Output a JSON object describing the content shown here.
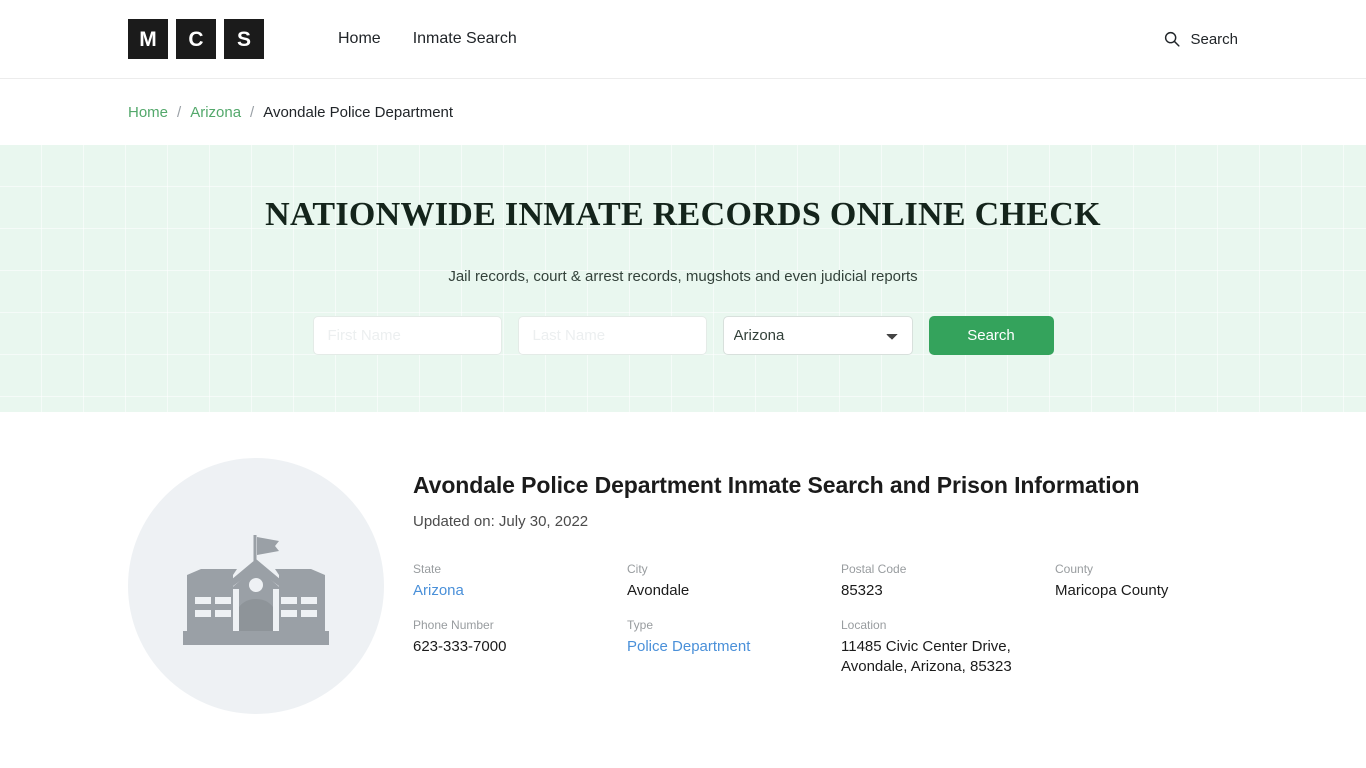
{
  "header": {
    "logo_letters": [
      "M",
      "C",
      "S"
    ],
    "nav": [
      {
        "label": "Home"
      },
      {
        "label": "Inmate Search"
      }
    ],
    "search_label": "Search",
    "search_icon": "search-icon"
  },
  "breadcrumb": {
    "items": [
      {
        "label": "Home",
        "link": true
      },
      {
        "label": "Arizona",
        "link": true
      },
      {
        "label": "Avondale Police Department",
        "link": false
      }
    ],
    "separator": "/"
  },
  "hero": {
    "title": "NATIONWIDE INMATE RECORDS ONLINE CHECK",
    "subtitle": "Jail records, court & arrest records, mugshots and even judicial reports",
    "form": {
      "first_name_placeholder": "First Name",
      "first_name_value": "",
      "last_name_placeholder": "Last Name",
      "last_name_value": "",
      "state_selected": "Arizona",
      "state_options": [
        "Arizona"
      ],
      "submit_label": "Search"
    },
    "background_color": "#e9f7ef",
    "accent_color": "#34a35c"
  },
  "main": {
    "thumbnail_icon": "government-building-icon",
    "title": "Avondale Police Department Inmate Search and Prison Information",
    "updated": "Updated on: July 30, 2022",
    "details": [
      {
        "label": "State",
        "value": "Arizona",
        "link": true
      },
      {
        "label": "City",
        "value": "Avondale",
        "link": false
      },
      {
        "label": "Postal Code",
        "value": "85323",
        "link": false
      },
      {
        "label": "County",
        "value": "Maricopa County",
        "link": false
      },
      {
        "label": "Phone Number",
        "value": "623-333-7000",
        "link": false
      },
      {
        "label": "Type",
        "value": "Police Department",
        "link": true
      },
      {
        "label": "Location",
        "value": "11485 Civic Center Drive, Avondale, Arizona, 85323",
        "link": false
      }
    ],
    "link_color": "#4a90d9"
  }
}
